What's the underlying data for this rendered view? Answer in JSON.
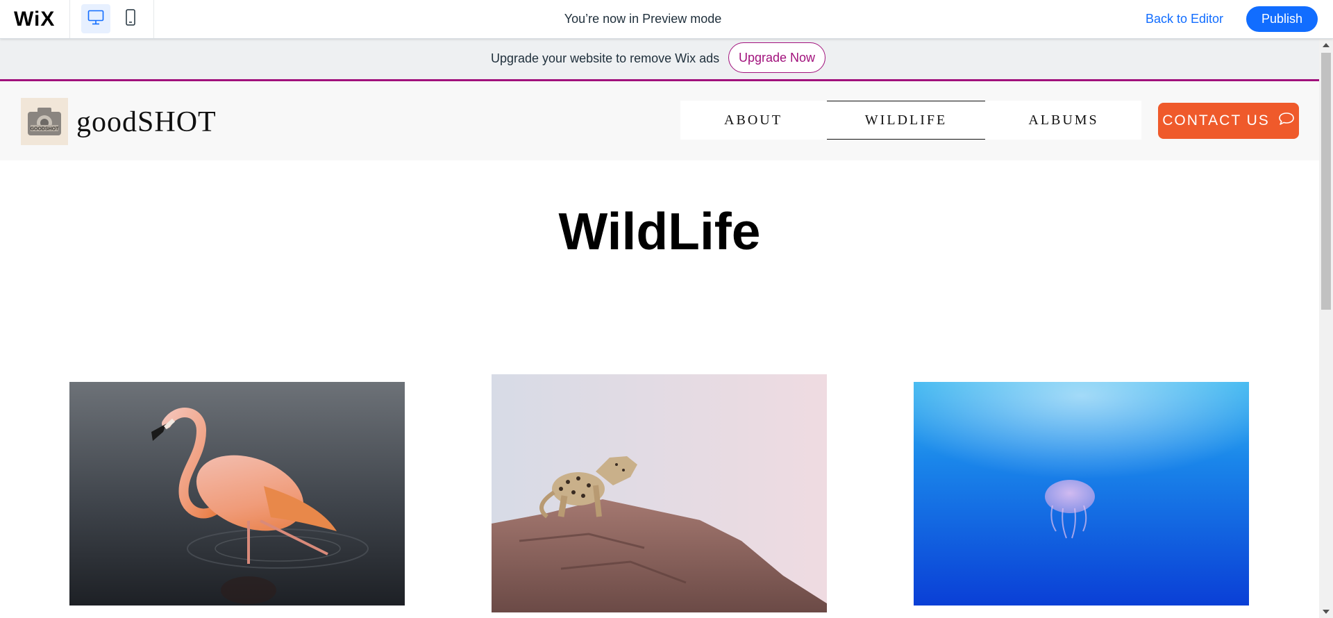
{
  "wix_toolbar": {
    "logo": "WiX",
    "preview_message": "You’re now in Preview mode",
    "back_to_editor": "Back to Editor",
    "publish": "Publish",
    "devices": [
      "desktop-icon",
      "mobile-icon"
    ],
    "accent_color": "#116dff"
  },
  "upgrade_banner": {
    "text": "Upgrade your website to remove Wix ads",
    "button": "Upgrade Now",
    "accent_color": "#a1117c"
  },
  "site_header": {
    "site_name": "goodSHOT",
    "logo_text": "GOODSHOT",
    "nav": [
      {
        "label": "ABOUT"
      },
      {
        "label": "WILDLIFE",
        "active": true
      },
      {
        "label": "ALBUMS"
      }
    ],
    "contact_button": "CONTACT US",
    "contact_color": "#ef5a2b"
  },
  "page": {
    "title": "WildLife",
    "gallery": [
      {
        "subject": "flamingo"
      },
      {
        "subject": "leopard"
      },
      {
        "subject": "jellyfish"
      }
    ]
  }
}
